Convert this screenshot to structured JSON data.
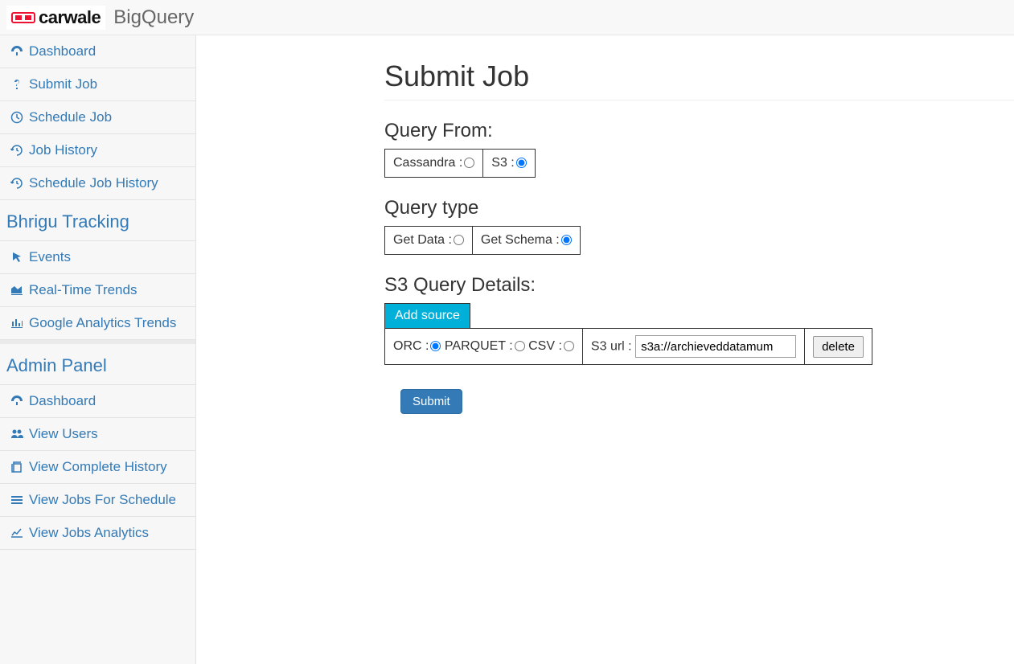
{
  "header": {
    "logo_text": "carwale",
    "app_title": "BigQuery"
  },
  "sidebar": {
    "main": [
      {
        "icon": "dashboard",
        "label": "Dashboard"
      },
      {
        "icon": "question",
        "label": "Submit Job"
      },
      {
        "icon": "clock",
        "label": "Schedule Job"
      },
      {
        "icon": "history",
        "label": "Job History"
      },
      {
        "icon": "history",
        "label": "Schedule Job History"
      }
    ],
    "tracking_header": "Bhrigu Tracking",
    "tracking": [
      {
        "icon": "pointer",
        "label": "Events"
      },
      {
        "icon": "area",
        "label": "Real-Time Trends"
      },
      {
        "icon": "bar",
        "label": "Google Analytics Trends"
      }
    ],
    "admin_header": "Admin Panel",
    "admin": [
      {
        "icon": "dashboard",
        "label": "Dashboard"
      },
      {
        "icon": "users",
        "label": "View Users"
      },
      {
        "icon": "copy",
        "label": "View Complete History"
      },
      {
        "icon": "list",
        "label": "View Jobs For Schedule"
      },
      {
        "icon": "line",
        "label": "View Jobs Analytics"
      }
    ]
  },
  "page": {
    "title": "Submit Job",
    "query_from": {
      "label": "Query From:",
      "options": [
        {
          "label": "Cassandra :",
          "checked": false
        },
        {
          "label": "S3 :",
          "checked": true
        }
      ]
    },
    "query_type": {
      "label": "Query type",
      "options": [
        {
          "label": "Get Data :",
          "checked": false
        },
        {
          "label": "Get Schema :",
          "checked": true
        }
      ]
    },
    "s3_details": {
      "label": "S3 Query Details:",
      "add_source": "Add source",
      "format_options": [
        {
          "label": "ORC :",
          "checked": true
        },
        {
          "label": "PARQUET :",
          "checked": false
        },
        {
          "label": "CSV :",
          "checked": false
        }
      ],
      "url_label": "S3 url : ",
      "url_value": "s3a://archieveddatamum",
      "delete": "delete"
    },
    "submit": "Submit"
  }
}
